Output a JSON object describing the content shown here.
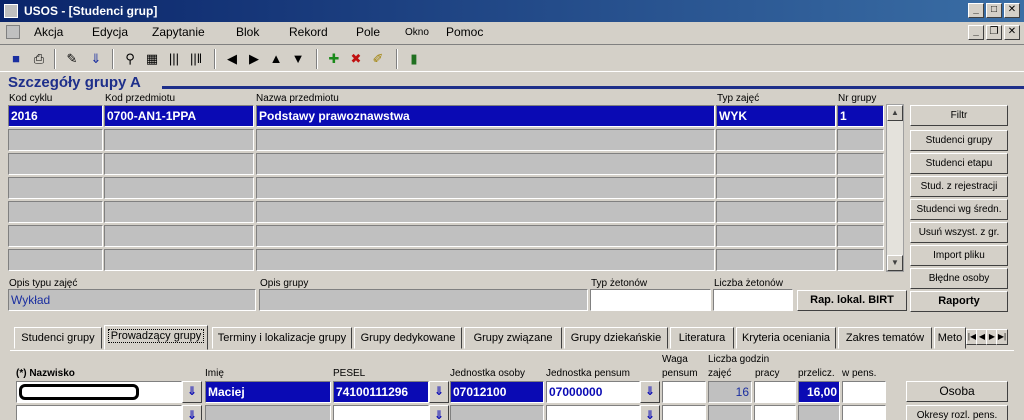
{
  "window": {
    "title": "USOS - [Studenci grup]"
  },
  "menu": {
    "items": [
      "Akcja",
      "Edycja",
      "Zapytanie",
      "Blok",
      "Rekord",
      "Pole",
      "Okno",
      "Pomoc"
    ]
  },
  "section": {
    "title": "Szczegóły grupy A"
  },
  "grid": {
    "headers": {
      "kod_cyklu": "Kod cyklu",
      "kod_przedmiotu": "Kod przedmiotu",
      "nazwa_przedmiotu": "Nazwa przedmiotu",
      "typ_zajec": "Typ zajęć",
      "nr_grupy": "Nr grupy"
    },
    "selected_row": {
      "kod_cyklu": "2016",
      "kod_przedmiotu": "0700-AN1-1PPA",
      "nazwa_przedmiotu": "Podstawy prawoznawstwa",
      "typ_zajec": "WYK",
      "nr_grupy": "1"
    }
  },
  "side_buttons": [
    "Filtr",
    "Studenci grupy",
    "Studenci etapu",
    "Stud. z rejestracji",
    "Studenci wg średn.",
    "Usuń wszyst. z gr.",
    "Import pliku",
    "Błędne osoby",
    "Raporty"
  ],
  "details": {
    "opis_typu_label": "Opis typu zajęć",
    "opis_typu_value": "Wykład",
    "opis_grupy_label": "Opis grupy",
    "typ_zetonow_label": "Typ żetonów",
    "liczba_zetonow_label": "Liczba żetonów",
    "rap_button": "Rap. lokal. BIRT"
  },
  "tabs": [
    "Studenci grupy",
    "Prowadzący grupy",
    "Terminy i lokalizacje grupy",
    "Grupy dedykowane",
    "Grupy związane",
    "Grupy dziekańskie",
    "Literatura",
    "Kryteria oceniania",
    "Zakres tematów",
    "Meto"
  ],
  "teachers": {
    "headers": {
      "nazwisko": "(*) Nazwisko",
      "imie": "Imię",
      "pesel": "PESEL",
      "jednostka_osoby": "Jednostka osoby",
      "jednostka_pensum": "Jednostka pensum",
      "waga": "Waga",
      "pensum": "pensum",
      "liczba_godzin": "Liczba godzin",
      "zajec": "zajęć",
      "pracy": "pracy",
      "przelicz": "przelicz.",
      "w_pens": "w pens."
    },
    "row": {
      "imie": "Maciej",
      "pesel": "74100111296",
      "jednostka_osoby": "07012100",
      "jednostka_pensum": "07000000",
      "zajec": "16",
      "przelicz": "16,00"
    },
    "buttons": [
      "Osoba",
      "Okresy rozl. pens."
    ]
  }
}
